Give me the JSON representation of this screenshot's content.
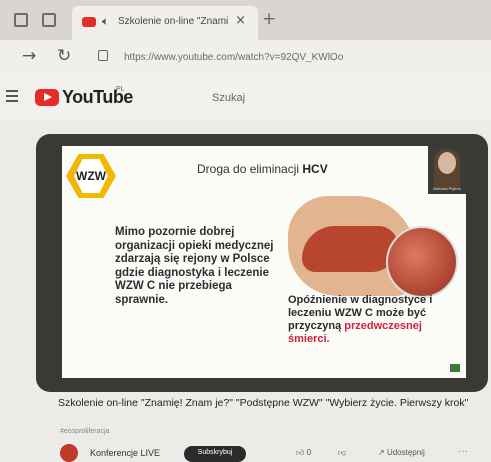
{
  "browser": {
    "tab_title": "Szkolenie on-line \"Znamię",
    "url": "https://www.youtube.com/watch?v=92QV_KWlOo"
  },
  "youtube": {
    "logo_text": "YouTube",
    "logo_suffix": "PL",
    "search_placeholder": "Szukaj"
  },
  "slide": {
    "logo_text": "WZW",
    "title_prefix": "Droga do eliminacji ",
    "title_bold": "HCV",
    "body": "Mimo pozornie dobrej organizacji opieki medycznej zdarzają się rejony w Polsce gdzie diagnostyka i leczenie WZW C nie przebiega sprawnie.",
    "callout_main": "Opóźnienie w diagnostyce i leczeniu WZW C może być przyczyną",
    "callout_red": "przedwczesnej śmierci.",
    "presenter": "Barbara Piękoś"
  },
  "video": {
    "title": "Szkolenie on-line \"Znamię! Znam je?\" \"Podstępne WZW\" \"Wybierz życie. Pierwszy krok\"",
    "hashtag": "#ecoproliferacja",
    "channel": "Konferencje LIVE",
    "subscribe": "Subskrybuj",
    "likes": "0",
    "share": "Udostępnij",
    "more": "···"
  },
  "colors": {
    "youtube_red": "#e52d27",
    "wzw_yellow": "#f2b705",
    "callout_red": "#d41f3c"
  }
}
